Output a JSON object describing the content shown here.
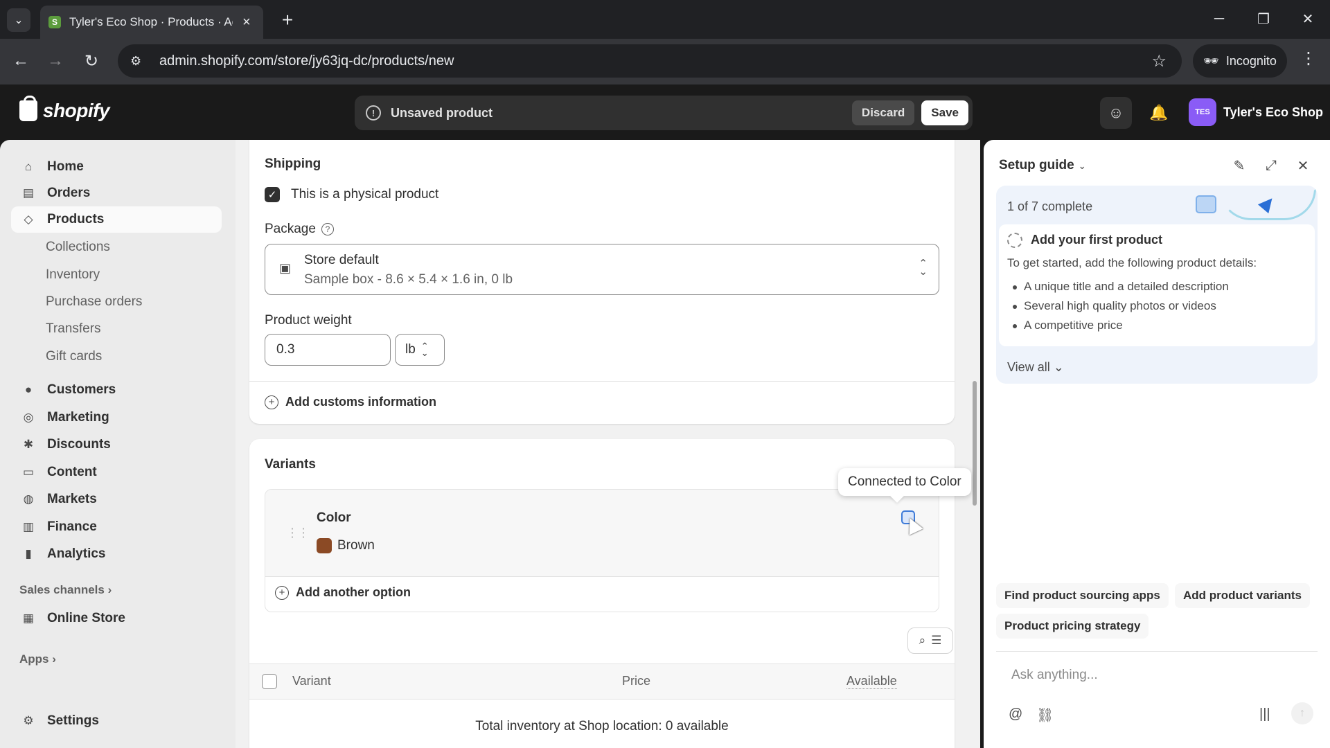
{
  "browser": {
    "tab_title": "Tyler's Eco Shop · Products · Ad",
    "url": "admin.shopify.com/store/jy63jq-dc/products/new",
    "incognito_label": "Incognito"
  },
  "topbar": {
    "logo_text": "shopify",
    "unsaved_label": "Unsaved product",
    "discard_label": "Discard",
    "save_label": "Save",
    "store_initials": "TES",
    "store_name": "Tyler's Eco Shop"
  },
  "sidebar": {
    "items": [
      {
        "label": "Home",
        "icon": "home-icon"
      },
      {
        "label": "Orders",
        "icon": "inbox-icon"
      },
      {
        "label": "Products",
        "icon": "tag-icon"
      },
      {
        "label": "Customers",
        "icon": "person-icon"
      },
      {
        "label": "Marketing",
        "icon": "target-icon"
      },
      {
        "label": "Discounts",
        "icon": "discount-icon"
      },
      {
        "label": "Content",
        "icon": "content-icon"
      },
      {
        "label": "Markets",
        "icon": "globe-icon"
      },
      {
        "label": "Finance",
        "icon": "bank-icon"
      },
      {
        "label": "Analytics",
        "icon": "bar-chart-icon"
      }
    ],
    "product_subitems": [
      "Collections",
      "Inventory",
      "Purchase orders",
      "Transfers",
      "Gift cards"
    ],
    "sales_channels_label": "Sales channels",
    "online_store_label": "Online Store",
    "apps_label": "Apps",
    "settings_label": "Settings"
  },
  "shipping": {
    "title": "Shipping",
    "physical_label": "This is a physical product",
    "physical_checked": true,
    "package_label": "Package",
    "package_name": "Store default",
    "package_detail": "Sample box - 8.6 × 5.4 × 1.6 in, 0 lb",
    "weight_label": "Product weight",
    "weight_value": "0.3",
    "weight_unit": "lb",
    "customs_label": "Add customs information"
  },
  "variants": {
    "title": "Variants",
    "option_name": "Color",
    "option_value": "Brown",
    "swatch_color": "#8b4a25",
    "tooltip": "Connected to Color",
    "add_option_label": "Add another option",
    "columns": [
      "Variant",
      "Price",
      "Available"
    ],
    "total_inventory": "Total inventory at Shop location: 0 available"
  },
  "setup_guide": {
    "title": "Setup guide",
    "progress": "1 of 7 complete",
    "step_title": "Add your first product",
    "step_desc": "To get started, add the following product details:",
    "bullets": [
      "A unique title and a detailed description",
      "Several high quality photos or videos",
      "A competitive price"
    ],
    "view_all": "View all",
    "suggestions": [
      "Find product sourcing apps",
      "Add product variants",
      "Product pricing strategy"
    ],
    "ask_placeholder": "Ask anything..."
  }
}
